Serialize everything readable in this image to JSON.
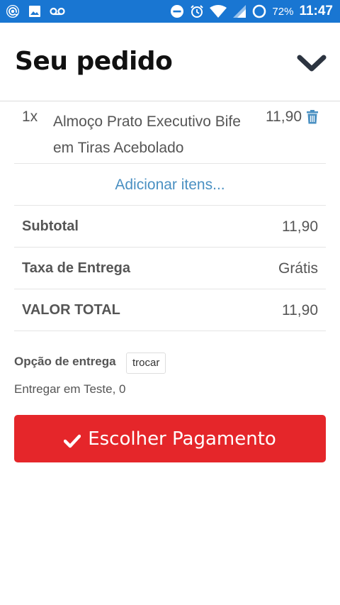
{
  "status_bar": {
    "battery": "72%",
    "time": "11:47",
    "icons_left": [
      "at-notification-icon",
      "image-icon",
      "voicemail-icon"
    ],
    "icons_right": [
      "do-not-disturb-icon",
      "alarm-icon",
      "wifi-icon",
      "signal-icon",
      "battery-icon"
    ],
    "background": "#1976d2"
  },
  "header": {
    "title": "Seu pedido"
  },
  "order": {
    "items": [
      {
        "qty": "1x",
        "name": "Almoço Prato Executivo Bife em Tiras Acebolado",
        "price": "11,90"
      }
    ],
    "add_items_label": "Adicionar itens..."
  },
  "summary": {
    "subtotal_label": "Subtotal",
    "subtotal_value": "11,90",
    "delivery_fee_label": "Taxa de Entrega",
    "delivery_fee_value": "Grátis",
    "total_label": "VALOR TOTAL",
    "total_value": "11,90"
  },
  "delivery": {
    "option_label": "Opção de entrega",
    "swap_label": "trocar",
    "address": "Entregar em Teste, 0"
  },
  "payment": {
    "button_label": "Escolher Pagamento",
    "button_color": "#e5262a"
  },
  "colors": {
    "link": "#4a90c2",
    "text": "#555555"
  }
}
